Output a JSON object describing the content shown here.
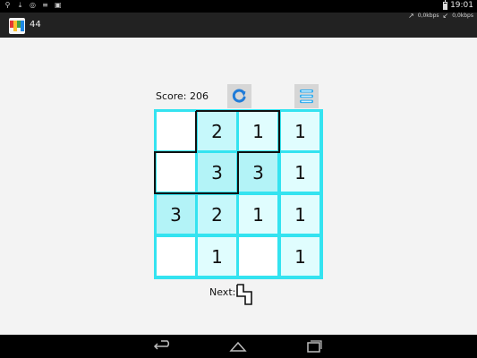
{
  "status_bar": {
    "time": "19:01",
    "left_icons": [
      "usb-icon",
      "download-icon",
      "wifi-settings-icon",
      "menu-lines-icon",
      "photo-icon"
    ]
  },
  "action_bar": {
    "title": "44",
    "up_speed": "0,0kbps",
    "down_speed": "0,0kbps"
  },
  "game": {
    "score_label": "Score: 206",
    "refresh_icon": "refresh-icon",
    "menu_icon": "menu-icon",
    "board": [
      [
        "",
        "2",
        "1",
        "1"
      ],
      [
        "",
        "3",
        "3",
        "1"
      ],
      [
        "3",
        "2",
        "1",
        "1"
      ],
      [
        "",
        "1",
        "",
        "1"
      ]
    ],
    "next_label": "Next:",
    "colors": {
      "grid_border": "#34e3f0",
      "accent_icon": "#1f7bd8"
    }
  },
  "nav_bar": {
    "icons": [
      "back-icon",
      "home-icon",
      "recents-icon"
    ]
  }
}
